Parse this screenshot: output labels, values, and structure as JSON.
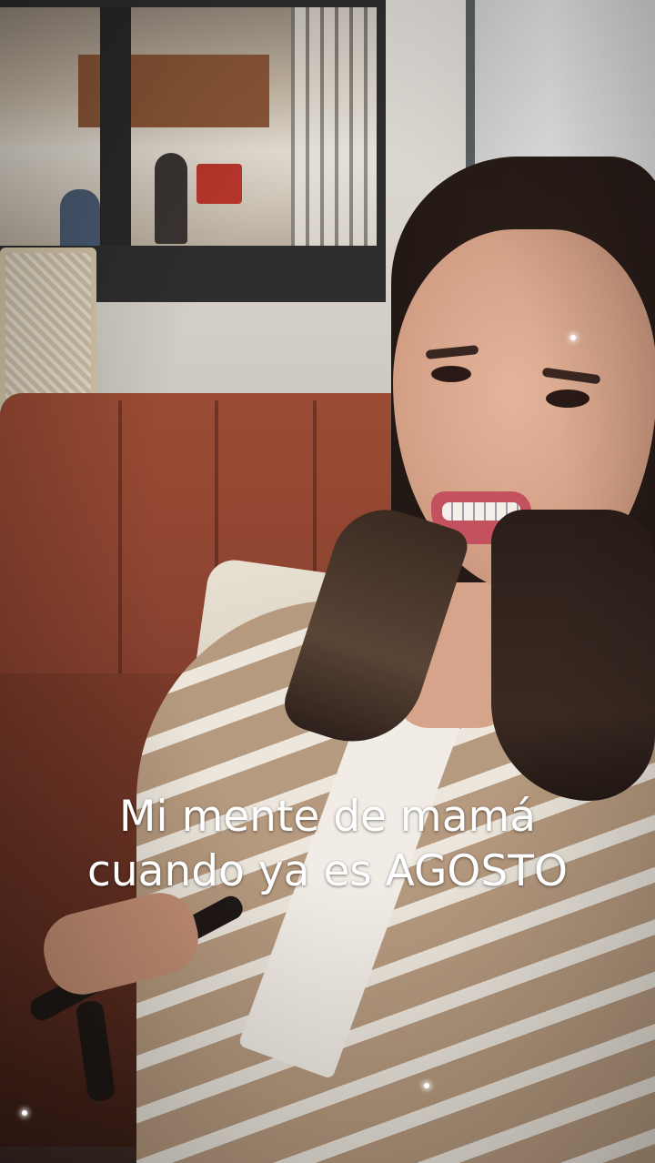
{
  "caption": {
    "line1": "Mi mente de mamá",
    "line2": "cuando ya es AGOSTO"
  },
  "colors": {
    "caption_text": "#ffffff",
    "sofa": "#8a4230",
    "shirt_stripe_dark": "#b69a7f",
    "shirt_stripe_light": "#ece6dc"
  }
}
